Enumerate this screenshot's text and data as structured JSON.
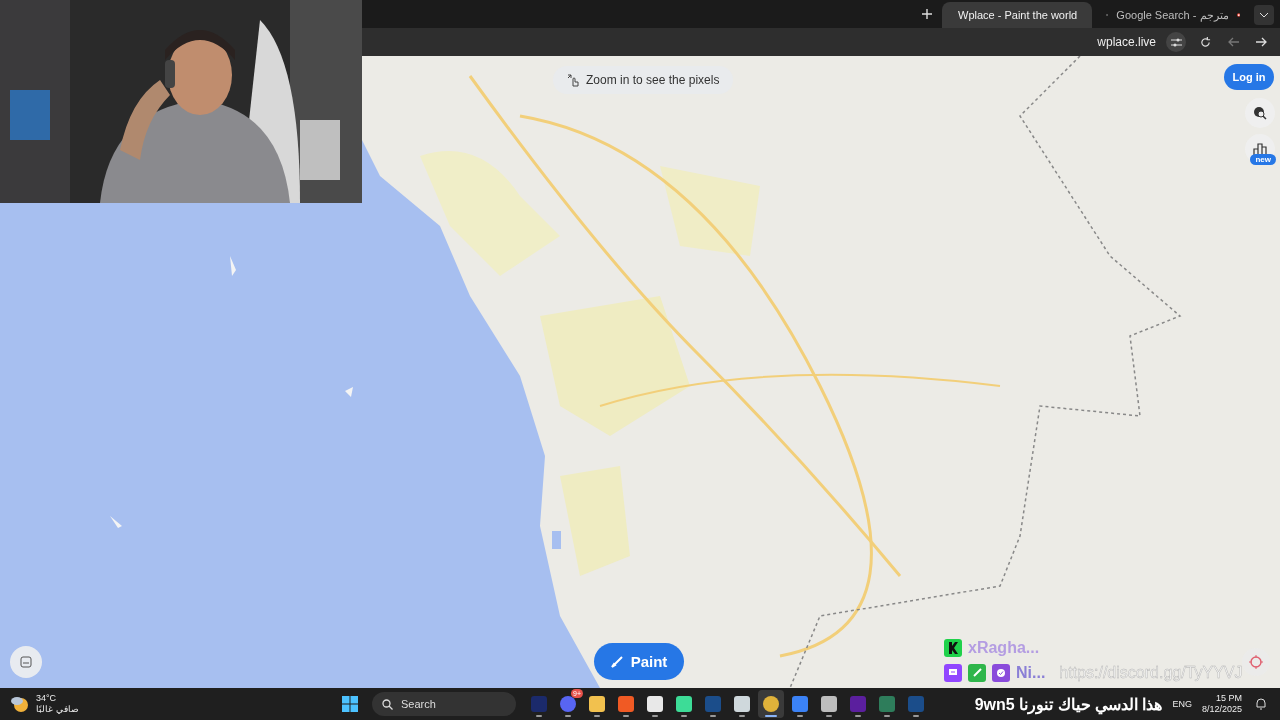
{
  "browser": {
    "tabs": [
      {
        "title": "Wplace - Paint the world",
        "selected": true
      },
      {
        "title": "Google Search - مترجم",
        "selected": false
      }
    ],
    "address": "wplace.live"
  },
  "map": {
    "hint": "Zoom in to see the pixels",
    "login": "Log in",
    "badge": "new",
    "paint": "Paint"
  },
  "stream_overlay": {
    "names": [
      "xRagha...",
      "Ni..."
    ],
    "link": "https://discord.gg/TyYYVJ",
    "ticker": "9wn5 هذا الدسي حياك تنورنا"
  },
  "taskbar": {
    "weather": {
      "temperature": "34°C",
      "condition": "صافي غالبًا"
    },
    "search": {
      "placeholder": "Search"
    },
    "apps": [
      {
        "kind": "news",
        "selected": false
      },
      {
        "kind": "discord",
        "selected": false,
        "badge": "9+"
      },
      {
        "kind": "files",
        "selected": false
      },
      {
        "kind": "brave",
        "selected": false
      },
      {
        "kind": "store",
        "selected": false
      },
      {
        "kind": "chat",
        "selected": false
      },
      {
        "kind": "steam",
        "selected": false
      },
      {
        "kind": "viewer",
        "selected": false
      },
      {
        "kind": "chrome",
        "selected": true
      },
      {
        "kind": "remote",
        "selected": false
      },
      {
        "kind": "server",
        "selected": false
      },
      {
        "kind": "nzxt",
        "selected": false
      },
      {
        "kind": "xbox",
        "selected": false
      },
      {
        "kind": "steam",
        "selected": false
      }
    ],
    "language": "ENG",
    "time": "15 PM",
    "date": "8/12/2025"
  }
}
